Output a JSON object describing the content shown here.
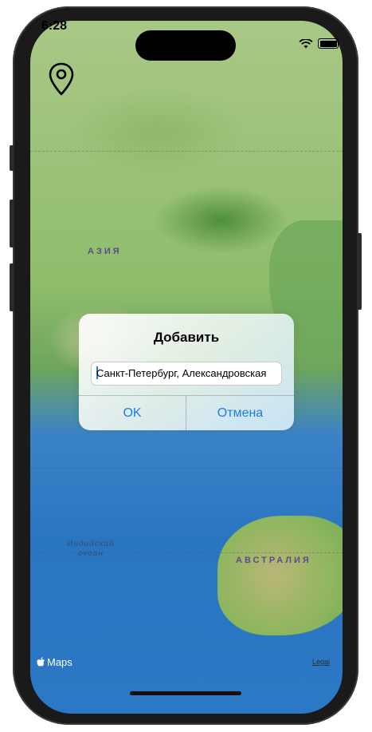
{
  "status_bar": {
    "time": "6:28"
  },
  "map": {
    "labels": {
      "asia": "АЗИЯ",
      "australia": "АВСТРАЛИЯ",
      "ocean": "Индийский океан"
    },
    "attribution": {
      "logo": "Maps",
      "legal": "Legal"
    }
  },
  "toolbar": {
    "location_button_icon": "map-pin-icon"
  },
  "alert": {
    "title": "Добавить",
    "input_value": "Санкт-Петербург, Александровская",
    "ok_label": "OK",
    "cancel_label": "Отмена"
  },
  "colors": {
    "accent": "#1a7cf0"
  }
}
